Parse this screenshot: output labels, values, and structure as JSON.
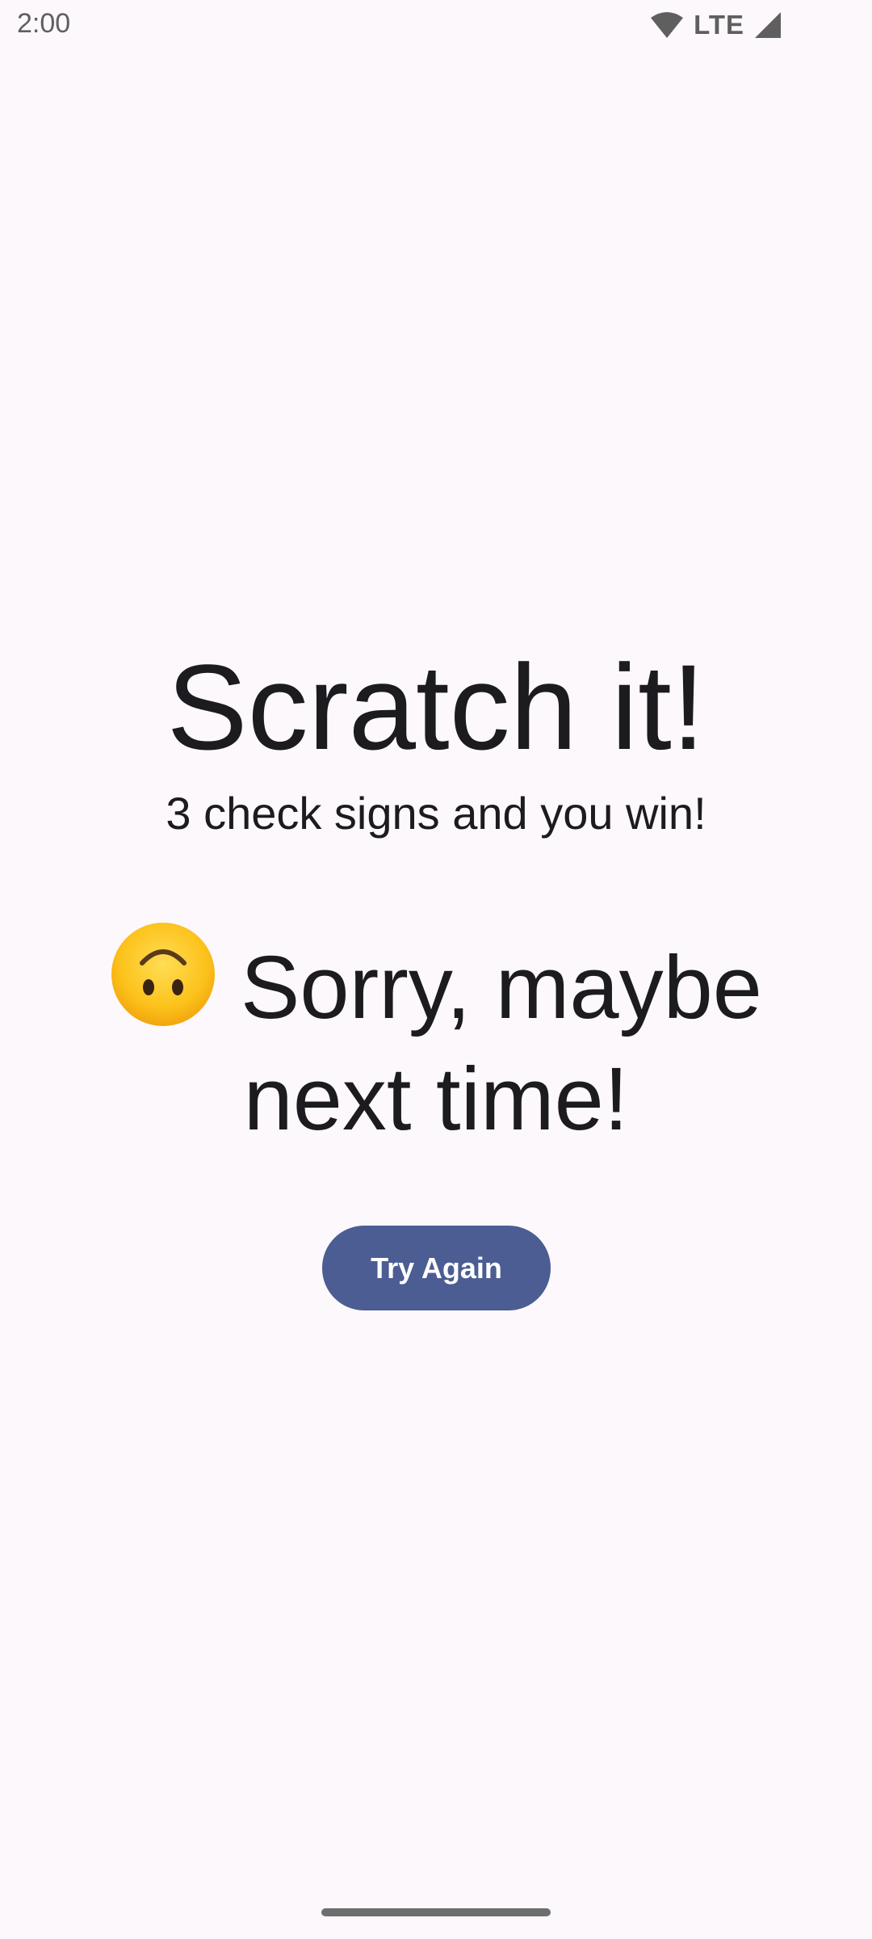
{
  "status_bar": {
    "time": "2:00",
    "network_label": "LTE",
    "icons": [
      "wifi-icon",
      "cell-signal-icon"
    ]
  },
  "main": {
    "title": "Scratch it!",
    "subtitle": "3 check signs and you win!",
    "result_emoji": "upside-down-face-emoji",
    "result_text": "Sorry, maybe next time!",
    "try_again_label": "Try Again"
  },
  "colors": {
    "background": "#fcf8fc",
    "accent": "#4b5d92",
    "text": "#1c1b1f"
  }
}
